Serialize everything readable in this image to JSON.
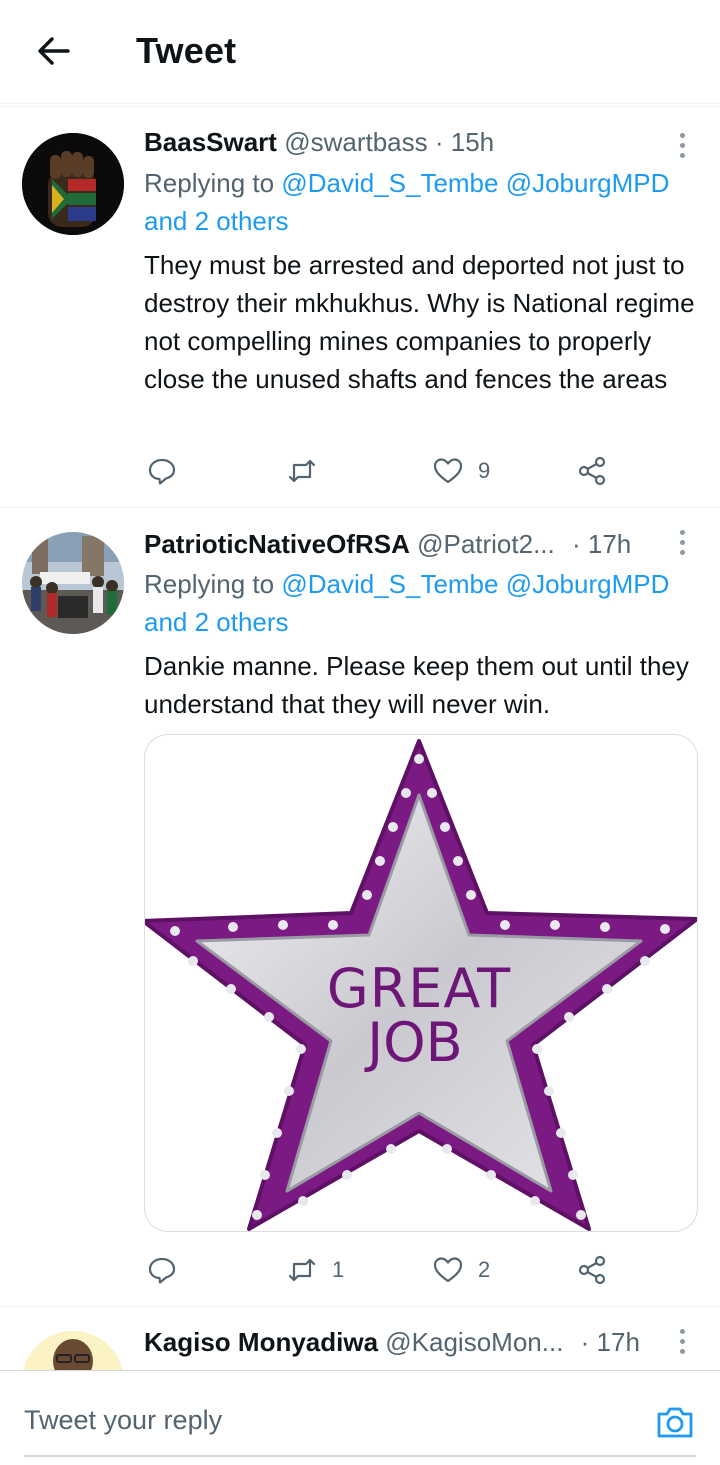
{
  "header": {
    "title": "Tweet",
    "back_icon": "arrow-left-icon"
  },
  "tweets": [
    {
      "name": "BaasSwart",
      "handle": "@swartbass",
      "time": "· 15h",
      "replying_prefix": "Replying to",
      "replying_mentions": "@David_S_Tembe @JoburgMPD",
      "replying_others": "and 2 others",
      "text": "They must be arrested and deported not just to destroy their mkhukhus. Why is National regime not compelling mines companies to properly close the unused shafts and fences the areas",
      "reply_count": "",
      "retweet_count": "",
      "like_count": "9"
    },
    {
      "name": "PatrioticNativeOfRSA",
      "handle": "@Patriot2...",
      "time": "· 17h",
      "replying_prefix": "Replying to",
      "replying_mentions": "@David_S_Tembe @JoburgMPD",
      "replying_others": "and 2 others",
      "text": "Dankie manne. Please keep them out until they understand that they will never win.",
      "media_text_line1": "GREAT",
      "media_text_line2": "JOB",
      "reply_count": "",
      "retweet_count": "1",
      "like_count": "2"
    },
    {
      "name": "Kagiso Monyadiwa",
      "handle": "@KagisoMon...",
      "time": "· 17h"
    }
  ],
  "reply_bar": {
    "placeholder": "Tweet your reply",
    "camera_icon": "camera-icon"
  },
  "colors": {
    "link": "#1d9bf0",
    "secondary": "#536471",
    "star_purple": "#7a1a82"
  }
}
